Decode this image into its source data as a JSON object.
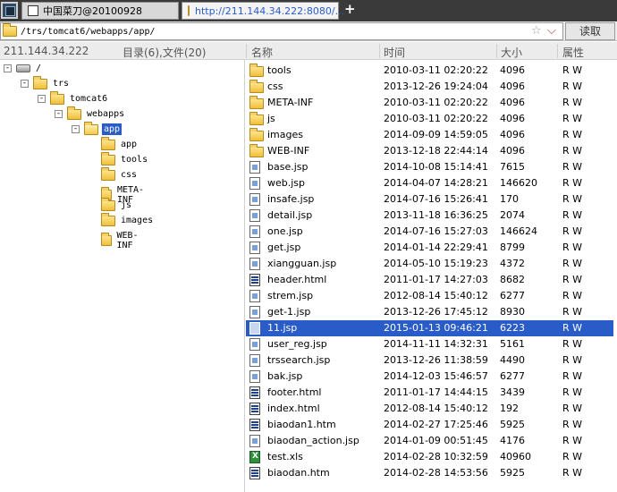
{
  "tabs": [
    {
      "label": "中国菜刀@20100928"
    },
    {
      "label": "http://211.144.34.222:8080/..."
    }
  ],
  "new_tab_label": "+",
  "address": {
    "path": "/trs/tomcat6/webapps/app/",
    "read_label": "读取",
    "star": "☆",
    "dropdown": "⌵"
  },
  "header": {
    "host": "211.144.34.222",
    "summary": "目录(6),文件(20)",
    "col_name": "名称",
    "col_time": "时间",
    "col_size": "大小",
    "col_attr": "属性"
  },
  "tree": [
    {
      "label": "/",
      "level": 0,
      "expander": "-",
      "icon": "drive"
    },
    {
      "label": "trs",
      "level": 1,
      "expander": "-",
      "icon": "folder"
    },
    {
      "label": "tomcat6",
      "level": 2,
      "expander": "-",
      "icon": "folder"
    },
    {
      "label": "webapps",
      "level": 3,
      "expander": "-",
      "icon": "folder"
    },
    {
      "label": "app",
      "level": 4,
      "expander": "-",
      "icon": "folder-open",
      "selected": true
    },
    {
      "label": "app",
      "level": 5,
      "icon": "folder"
    },
    {
      "label": "tools",
      "level": 5,
      "icon": "folder"
    },
    {
      "label": "css",
      "level": 5,
      "icon": "folder"
    },
    {
      "label": "META-INF",
      "level": 5,
      "icon": "folder"
    },
    {
      "label": "js",
      "level": 5,
      "icon": "folder"
    },
    {
      "label": "images",
      "level": 5,
      "icon": "folder"
    },
    {
      "label": "WEB-INF",
      "level": 5,
      "icon": "folder"
    }
  ],
  "files": [
    {
      "name": "tools",
      "time": "2010-03-11 02:20:22",
      "size": "4096",
      "attr": "R W",
      "icon": "folder"
    },
    {
      "name": "css",
      "time": "2013-12-26 19:24:04",
      "size": "4096",
      "attr": "R W",
      "icon": "folder"
    },
    {
      "name": "META-INF",
      "time": "2010-03-11 02:20:22",
      "size": "4096",
      "attr": "R W",
      "icon": "folder"
    },
    {
      "name": "js",
      "time": "2010-03-11 02:20:22",
      "size": "4096",
      "attr": "R W",
      "icon": "folder"
    },
    {
      "name": "images",
      "time": "2014-09-09 14:59:05",
      "size": "4096",
      "attr": "R W",
      "icon": "folder"
    },
    {
      "name": "WEB-INF",
      "time": "2013-12-18 22:44:14",
      "size": "4096",
      "attr": "R W",
      "icon": "folder"
    },
    {
      "name": "base.jsp",
      "time": "2014-10-08 15:14:41",
      "size": "7615",
      "attr": "R W",
      "icon": "file"
    },
    {
      "name": "web.jsp",
      "time": "2014-04-07 14:28:21",
      "size": "146620",
      "attr": "R W",
      "icon": "file"
    },
    {
      "name": "insafe.jsp",
      "time": "2014-07-16 15:26:41",
      "size": "170",
      "attr": "R W",
      "icon": "file"
    },
    {
      "name": "detail.jsp",
      "time": "2013-11-18 16:36:25",
      "size": "2074",
      "attr": "R W",
      "icon": "file"
    },
    {
      "name": "one.jsp",
      "time": "2014-07-16 15:27:03",
      "size": "146624",
      "attr": "R W",
      "icon": "file"
    },
    {
      "name": "get.jsp",
      "time": "2014-01-14 22:29:41",
      "size": "8799",
      "attr": "R W",
      "icon": "file"
    },
    {
      "name": "xiangguan.jsp",
      "time": "2014-05-10 15:19:23",
      "size": "4372",
      "attr": "R W",
      "icon": "file"
    },
    {
      "name": "header.html",
      "time": "2011-01-17 14:27:03",
      "size": "8682",
      "attr": "R W",
      "icon": "htm"
    },
    {
      "name": "strem.jsp",
      "time": "2012-08-14 15:40:12",
      "size": "6277",
      "attr": "R W",
      "icon": "file"
    },
    {
      "name": "get-1.jsp",
      "time": "2013-12-26 17:45:12",
      "size": "8930",
      "attr": "R W",
      "icon": "file"
    },
    {
      "name": "11.jsp",
      "time": "2015-01-13 09:46:21",
      "size": "6223",
      "attr": "R W",
      "icon": "file",
      "selected": true
    },
    {
      "name": "user_reg.jsp",
      "time": "2014-11-11 14:32:31",
      "size": "5161",
      "attr": "R W",
      "icon": "file"
    },
    {
      "name": "trssearch.jsp",
      "time": "2013-12-26 11:38:59",
      "size": "4490",
      "attr": "R W",
      "icon": "file"
    },
    {
      "name": "bak.jsp",
      "time": "2014-12-03 15:46:57",
      "size": "6277",
      "attr": "R W",
      "icon": "file"
    },
    {
      "name": "footer.html",
      "time": "2011-01-17 14:44:15",
      "size": "3439",
      "attr": "R W",
      "icon": "htm"
    },
    {
      "name": "index.html",
      "time": "2012-08-14 15:40:12",
      "size": "192",
      "attr": "R W",
      "icon": "htm"
    },
    {
      "name": "biaodan1.htm",
      "time": "2014-02-27 17:25:46",
      "size": "5925",
      "attr": "R W",
      "icon": "htm"
    },
    {
      "name": "biaodan_action.jsp",
      "time": "2014-01-09 00:51:45",
      "size": "4176",
      "attr": "R W",
      "icon": "file"
    },
    {
      "name": "test.xls",
      "time": "2014-02-28 10:32:59",
      "size": "40960",
      "attr": "R W",
      "icon": "xls"
    },
    {
      "name": "biaodan.htm",
      "time": "2014-02-28 14:53:56",
      "size": "5925",
      "attr": "R W",
      "icon": "htm"
    }
  ]
}
